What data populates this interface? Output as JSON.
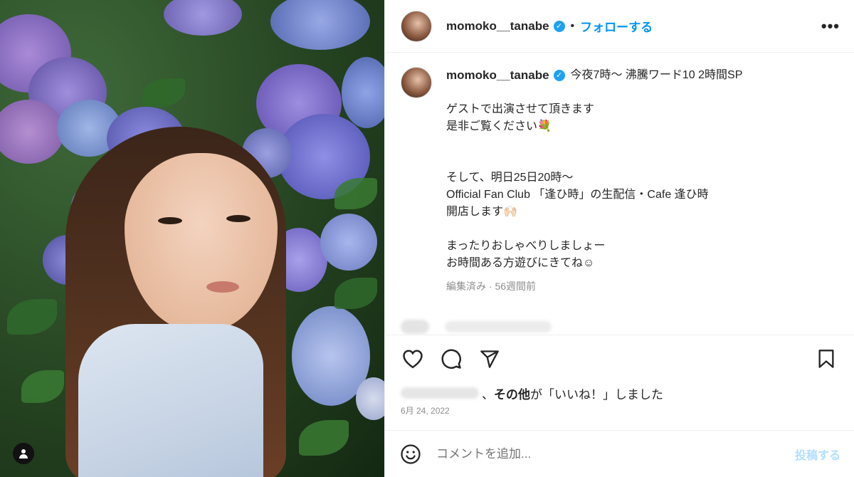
{
  "header": {
    "username": "momoko__tanabe",
    "separator": "•",
    "follow_label": "フォローする",
    "more_label": "•••"
  },
  "caption": {
    "username": "momoko__tanabe",
    "first_line": "今夜7時〜 沸騰ワード10 2時間SP",
    "lines": [
      "ゲストで出演させて頂きます",
      "是非ご覧ください💐",
      "",
      "",
      "そして、明日25日20時〜",
      "Official Fan Club 「逢ひ時」の生配信・Cafe 逢ひ時",
      "開店します🙌🏻",
      "",
      "まったりおしゃべりしましょー",
      "お時間ある方遊びにきてね☺"
    ],
    "meta": "編集済み · 56週間前"
  },
  "likes": {
    "others_label": "その他",
    "suffix": "が「いいね！」しました",
    "separator": "、"
  },
  "date": "6月 24, 2022",
  "comment": {
    "placeholder": "コメントを追加...",
    "post_label": "投稿する"
  },
  "colors": {
    "accent": "#0095f6",
    "post_disabled": "#b2dffc",
    "verified": "#1da1f2"
  },
  "icons": {
    "like": "heart-icon",
    "comment": "comment-icon",
    "share": "share-icon",
    "save": "bookmark-icon",
    "emoji": "smiley-icon",
    "tag": "user-tag-icon"
  }
}
